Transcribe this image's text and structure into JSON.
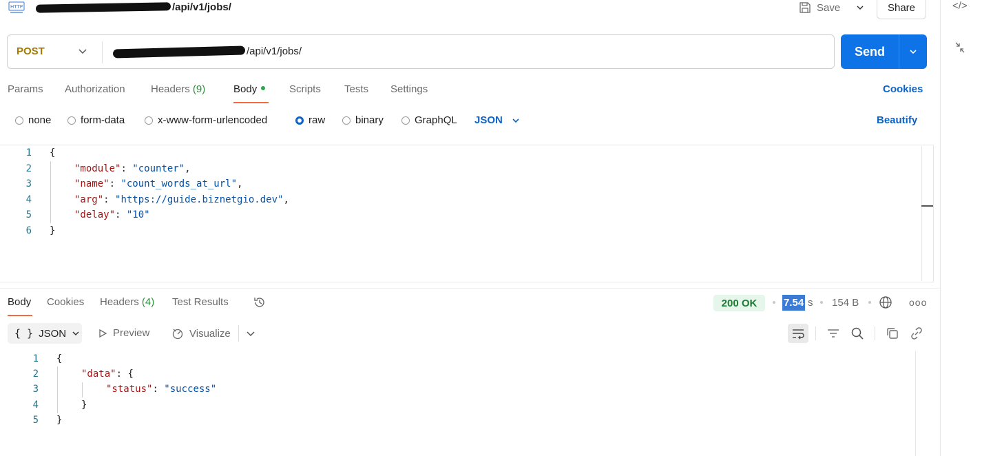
{
  "titlebar": {
    "url_suffix": "/api/v1/jobs/",
    "save_label": "Save",
    "share_label": "Share"
  },
  "request": {
    "method": "POST",
    "url_suffix": "/api/v1/jobs/",
    "send_label": "Send"
  },
  "req_tabs": {
    "params": "Params",
    "authorization": "Authorization",
    "headers": "Headers",
    "headers_count": "(9)",
    "body": "Body",
    "scripts": "Scripts",
    "tests": "Tests",
    "settings": "Settings",
    "cookies": "Cookies"
  },
  "body_types": {
    "none": "none",
    "form_data": "form-data",
    "urlencoded": "x-www-form-urlencoded",
    "raw": "raw",
    "binary": "binary",
    "graphql": "GraphQL",
    "format": "JSON",
    "beautify": "Beautify"
  },
  "request_body": {
    "line_numbers": [
      "1",
      "2",
      "3",
      "4",
      "5",
      "6"
    ],
    "open": "{",
    "close": "}",
    "fields": [
      {
        "key": "\"module\"",
        "value": "\"counter\"",
        "trail": ","
      },
      {
        "key": "\"name\"",
        "value": "\"count_words_at_url\"",
        "trail": ","
      },
      {
        "key": "\"arg\"",
        "value": "\"https://guide.biznetgio.dev\"",
        "trail": ","
      },
      {
        "key": "\"delay\"",
        "value": "\"10\"",
        "trail": ""
      }
    ]
  },
  "resp_tabs": {
    "body": "Body",
    "cookies": "Cookies",
    "headers": "Headers",
    "headers_count": "(4)",
    "test_results": "Test Results"
  },
  "response_meta": {
    "status": "200 OK",
    "time_value": "7.54",
    "time_unit": "s",
    "size": "154 B",
    "more": "ooo"
  },
  "response_toolbar": {
    "format": "JSON",
    "format_icon": "{ }",
    "preview": "Preview",
    "visualize": "Visualize"
  },
  "response_body": {
    "line_numbers": [
      "1",
      "2",
      "3",
      "4",
      "5"
    ],
    "open": "{",
    "data_key": "\"data\"",
    "data_open": "{",
    "status_key": "\"status\"",
    "status_value": "\"success\"",
    "data_close": "}",
    "close": "}"
  },
  "colors": {
    "send": "#0f73e8",
    "method": "#a57a00",
    "link": "#0b63c9",
    "active_tab_underline": "#f26b3a",
    "status_ok_bg": "#e7f6ea",
    "json_key": "#a31515",
    "json_string": "#0451a5"
  }
}
